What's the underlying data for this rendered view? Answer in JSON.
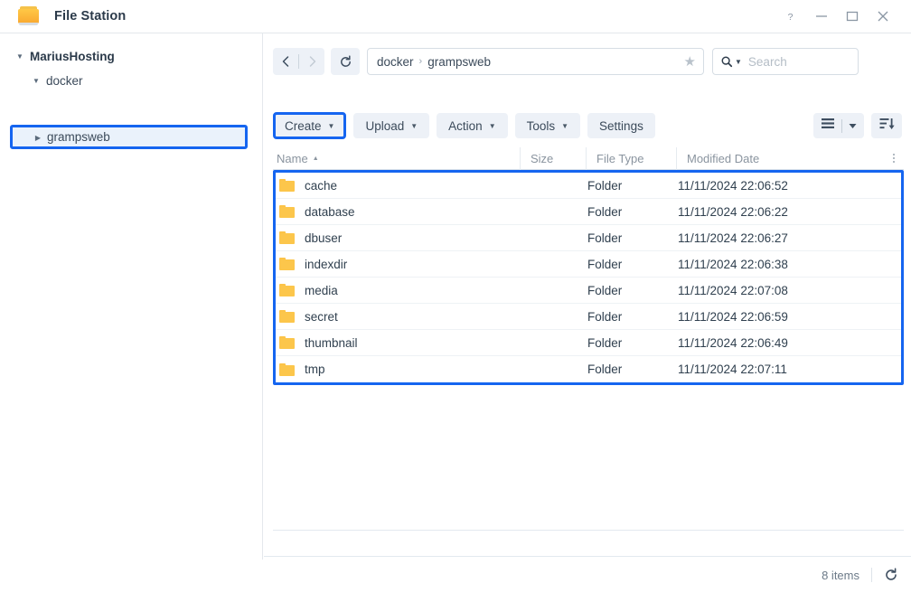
{
  "window": {
    "title": "File Station",
    "app_icon": "folder-icon",
    "controls": [
      {
        "name": "help-button",
        "glyph": "?"
      },
      {
        "name": "minimize-button",
        "glyph": "−"
      },
      {
        "name": "maximize-button",
        "glyph": "□"
      },
      {
        "name": "close-button",
        "glyph": "✕"
      }
    ]
  },
  "sidebar": {
    "items": [
      {
        "label": "MariusHosting",
        "level": 0,
        "caret": "down"
      },
      {
        "label": "docker",
        "level": 1,
        "caret": "down"
      },
      {
        "label": "grampsweb",
        "level": 2,
        "caret": "right",
        "highlighted": true
      }
    ]
  },
  "nav": {
    "back": "‹",
    "forward": "›",
    "refresh": "refresh-icon",
    "breadcrumb": [
      "docker",
      "grampsweb"
    ],
    "favorite_icon": "star-icon"
  },
  "search": {
    "placeholder": "Search",
    "icon": "search-icon"
  },
  "toolbar": {
    "buttons": [
      {
        "label": "Create",
        "dropdown": true,
        "highlighted": true
      },
      {
        "label": "Upload",
        "dropdown": true,
        "highlighted": false
      },
      {
        "label": "Action",
        "dropdown": true,
        "highlighted": false
      },
      {
        "label": "Tools",
        "dropdown": true,
        "highlighted": false
      },
      {
        "label": "Settings",
        "dropdown": false,
        "highlighted": false
      }
    ],
    "view_mode_icon": "list-view-icon",
    "sort_icon": "sort-descending-icon"
  },
  "table": {
    "columns": [
      "Name",
      "Size",
      "File Type",
      "Modified Date"
    ],
    "sort_column": "Name",
    "sort_direction": "asc",
    "rows": [
      {
        "name": "cache",
        "size": "",
        "type": "Folder",
        "modified": "11/11/2024 22:06:52"
      },
      {
        "name": "database",
        "size": "",
        "type": "Folder",
        "modified": "11/11/2024 22:06:22"
      },
      {
        "name": "dbuser",
        "size": "",
        "type": "Folder",
        "modified": "11/11/2024 22:06:27"
      },
      {
        "name": "indexdir",
        "size": "",
        "type": "Folder",
        "modified": "11/11/2024 22:06:38"
      },
      {
        "name": "media",
        "size": "",
        "type": "Folder",
        "modified": "11/11/2024 22:07:08"
      },
      {
        "name": "secret",
        "size": "",
        "type": "Folder",
        "modified": "11/11/2024 22:06:59"
      },
      {
        "name": "thumbnail",
        "size": "",
        "type": "Folder",
        "modified": "11/11/2024 22:06:49"
      },
      {
        "name": "tmp",
        "size": "",
        "type": "Folder",
        "modified": "11/11/2024 22:07:11"
      }
    ]
  },
  "status": {
    "items_count": "8 items",
    "refresh_icon": "refresh-icon"
  },
  "colors": {
    "annotation_blue": "#1565f0",
    "folder_yellow": "#fcc64b",
    "button_bg": "#edf1f7",
    "text": "#30404f"
  }
}
